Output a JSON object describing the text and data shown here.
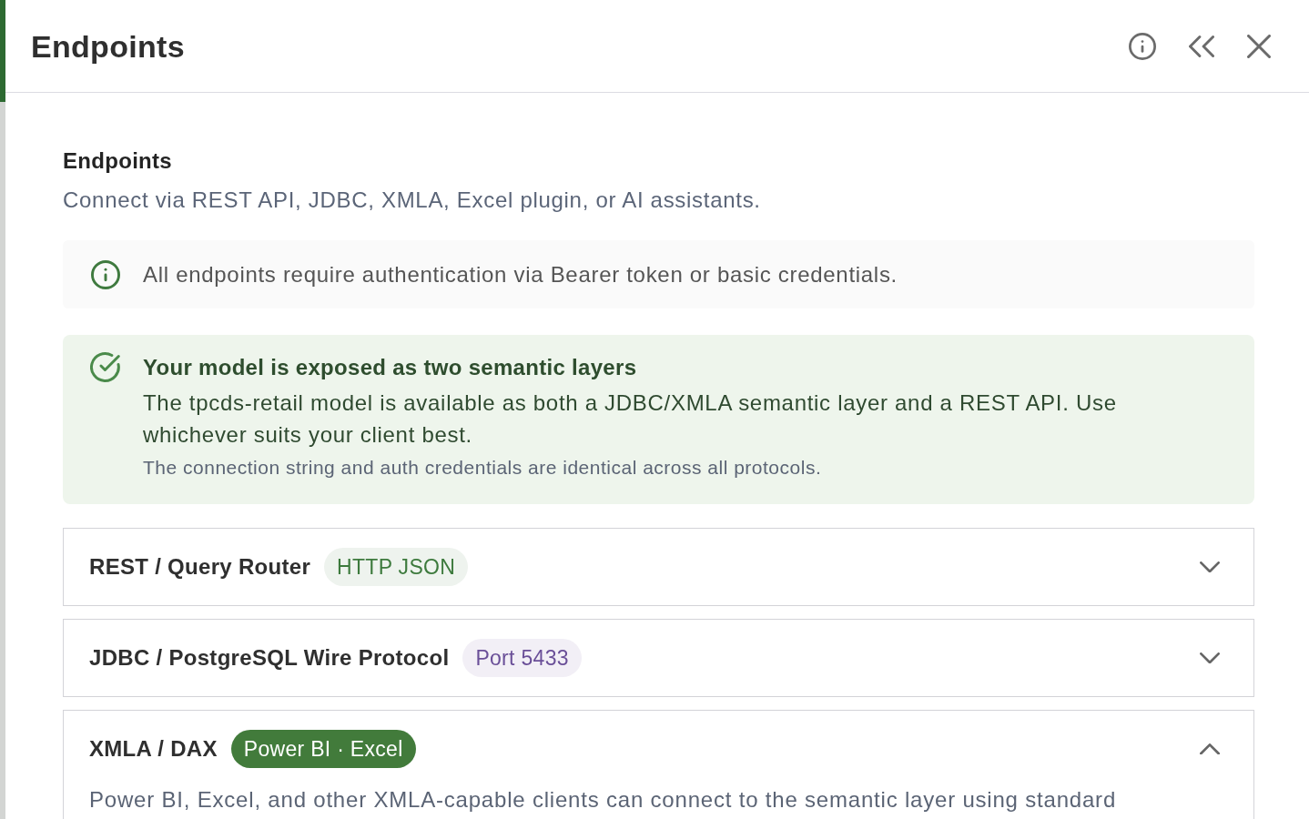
{
  "panel": {
    "title": "Endpoints"
  },
  "section": {
    "title": "Endpoints",
    "subtitle": "Connect via REST API, JDBC, XMLA, Excel plugin, or AI assistants."
  },
  "info_notice": {
    "text": "All endpoints require authentication via Bearer token or basic credentials."
  },
  "success_callout": {
    "title": "Your model is exposed as two semantic layers",
    "body": "The tpcds-retail model is available as both a JDBC/XMLA semantic layer and a REST API. Use whichever suits your client best.",
    "note": "The connection string and auth credentials are identical across all protocols."
  },
  "endpoints": [
    {
      "name": "REST / Query Router",
      "badge": {
        "label": "HTTP JSON",
        "kind": "soft",
        "color": "#3d7a3d"
      },
      "expanded": false
    },
    {
      "name": "JDBC / PostgreSQL Wire Protocol",
      "badge": {
        "label": "Port 5433",
        "kind": "soft",
        "color": "#6a4f98"
      },
      "expanded": false
    },
    {
      "name": "XMLA / DAX",
      "badge": {
        "label": "Power BI · Excel",
        "kind": "solid",
        "color": "#427b3b"
      },
      "expanded": true,
      "description": "Power BI, Excel, and other XMLA-capable clients can connect to the semantic layer using standard"
    }
  ]
}
